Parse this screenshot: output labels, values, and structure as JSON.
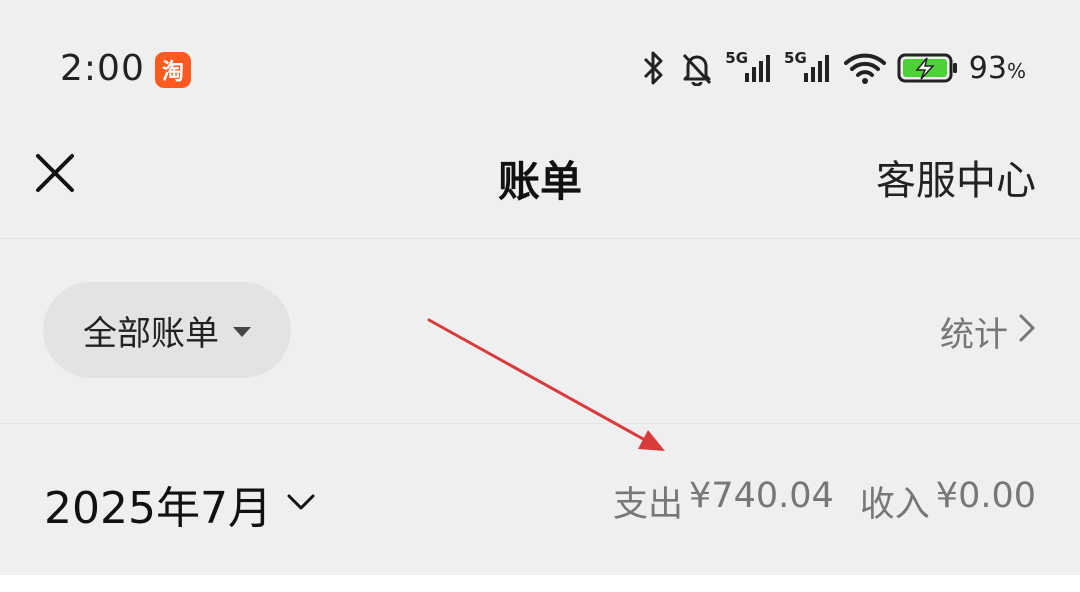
{
  "status_bar": {
    "time": "2:00",
    "app_badge": "淘",
    "net1": "5G",
    "net2": "5G",
    "battery_percent": "93",
    "battery_unit": "%"
  },
  "nav": {
    "title": "账单",
    "right_label": "客服中心"
  },
  "filter": {
    "selected": "全部账单",
    "stats_label": "统计"
  },
  "month": {
    "label": "2025年7月",
    "expense_label": "支出",
    "expense_value": "¥740.04",
    "income_label": "收入",
    "income_value": "¥0.00"
  },
  "colors": {
    "annotation_arrow": "#d93a3a",
    "app_badge": "#ff5a1f",
    "battery_fill": "#4cd137"
  }
}
